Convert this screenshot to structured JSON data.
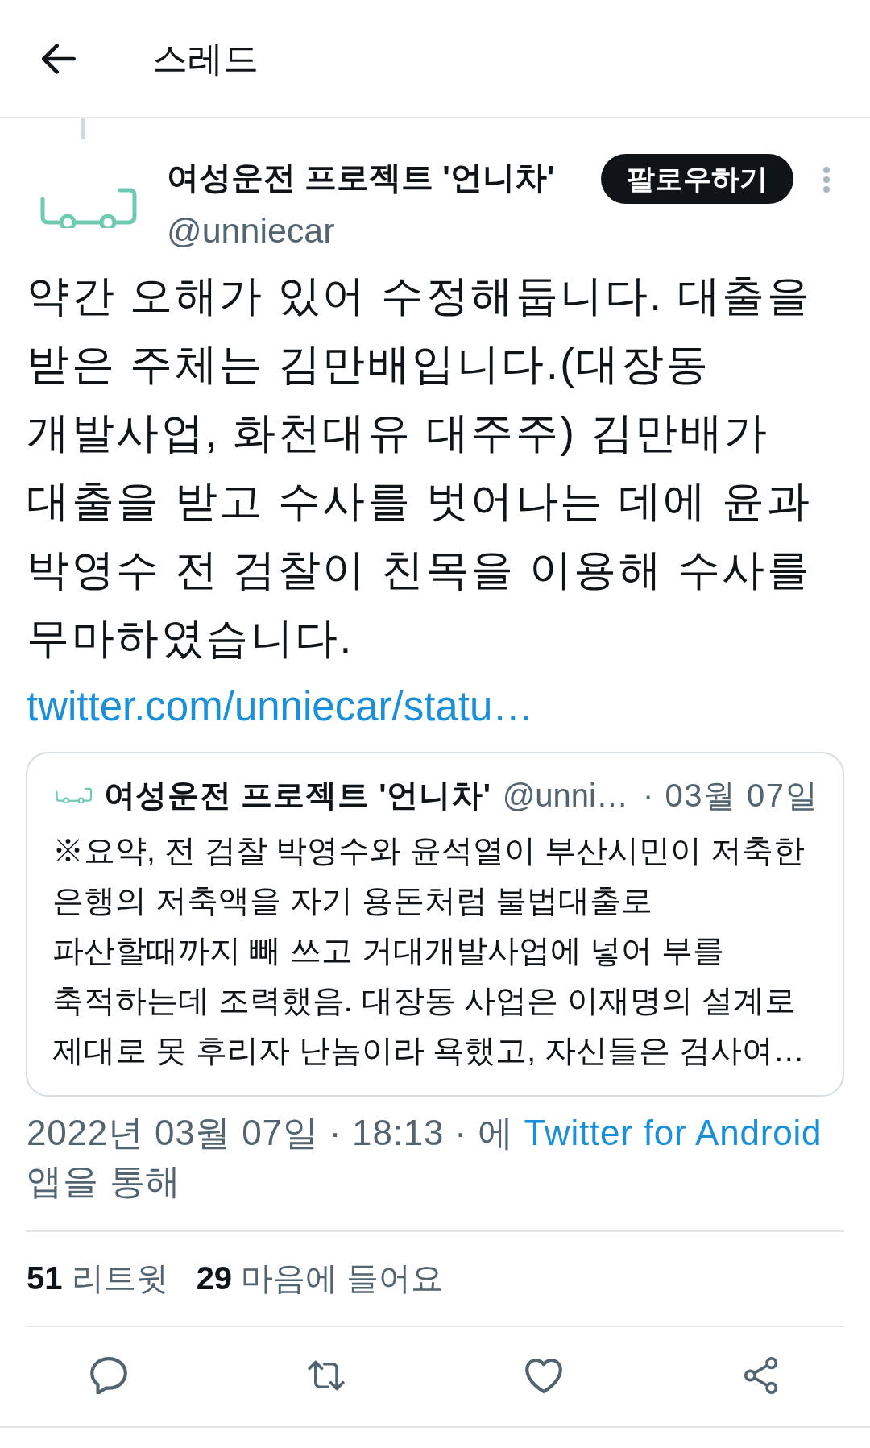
{
  "header": {
    "title": "스레드"
  },
  "tweet": {
    "author": {
      "name": "여성운전 프로젝트 '언니차'",
      "handle": "@unniecar"
    },
    "follow_button": {
      "label": "팔로우하기"
    },
    "text": "약간 오해가 있어 수정해둡니다. 대출을 받은 주체는 김만배입니다.(대장동 개발사업, 화천대유 대주주) 김만배가 대출을 받고 수사를 벗어나는 데에 윤과 박영수 전 검찰이 친목을 이용해 수사를 무마하였습니다.",
    "link": "twitter.com/unniecar/statu…",
    "quoted_tweet": {
      "name": "여성운전 프로젝트 '언니차'",
      "handle": "@unni…",
      "date": "· 03월 07일",
      "text": "※요약, 전 검찰 박영수와 윤석열이 부산시민이 저축한 은행의 저축액을 자기 용돈처럼 불법대출로 파산할때까지 빼 쓰고 거대개발사업에 넣어 부를 축적하는데 조력했음. 대장동 사업은 이재명의 설계로 제대로 못 후리자 난놈이라 욕했고, 자신들은 검사여…"
    },
    "timestamp": {
      "text": "2022년 03월 07일 · 18:13 · 에",
      "source": "Twitter for Android",
      "suffix": "앱을 통해"
    },
    "stats": [
      "**51** 리트윗",
      "**29** 마음에 들어요"
    ]
  }
}
